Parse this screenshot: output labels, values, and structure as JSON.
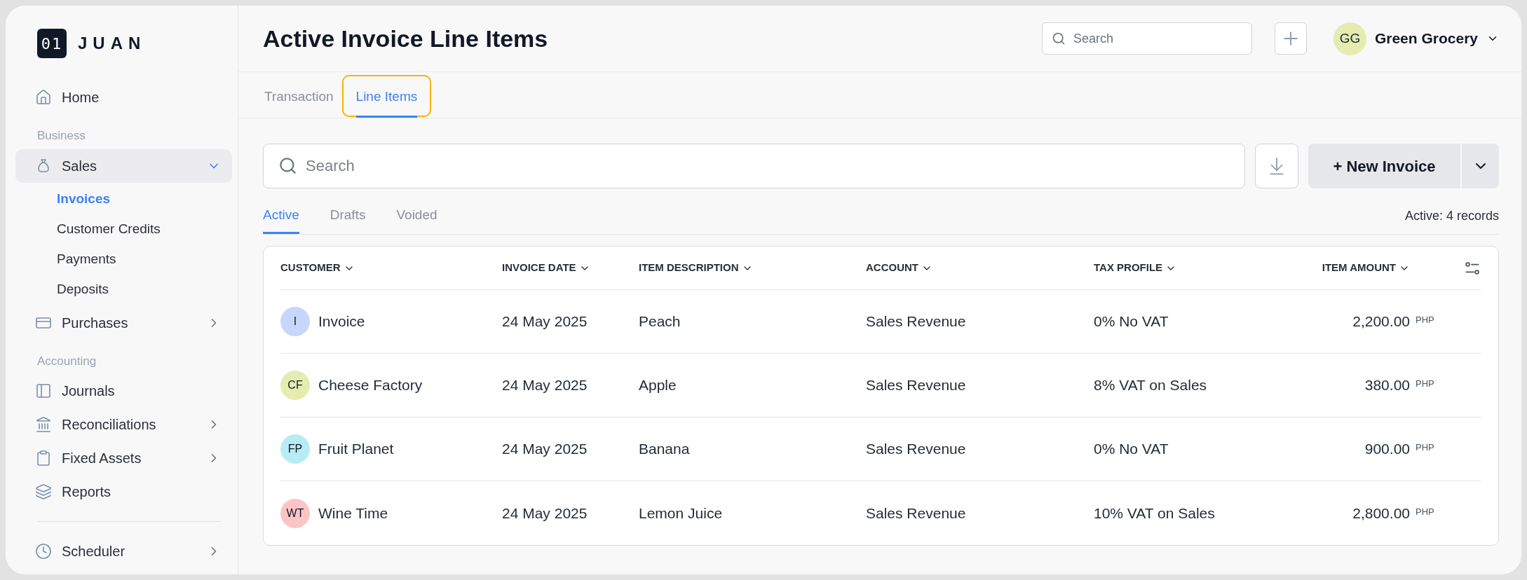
{
  "brand": {
    "badge": "01",
    "name": "JUAN"
  },
  "sidebar": {
    "nav": [
      {
        "kind": "item",
        "label": "Home"
      },
      {
        "kind": "heading",
        "label": "Business"
      },
      {
        "kind": "item",
        "label": "Sales",
        "expanded": true,
        "children": [
          {
            "label": "Invoices",
            "selected": true
          },
          {
            "label": "Customer Credits",
            "selected": false
          },
          {
            "label": "Payments",
            "selected": false
          },
          {
            "label": "Deposits",
            "selected": false
          }
        ]
      },
      {
        "kind": "item",
        "label": "Purchases",
        "expanded": false
      },
      {
        "kind": "heading",
        "label": "Accounting"
      },
      {
        "kind": "item",
        "label": "Journals"
      },
      {
        "kind": "item",
        "label": "Reconciliations",
        "expanded": false
      },
      {
        "kind": "item",
        "label": "Fixed Assets",
        "expanded": false
      },
      {
        "kind": "item",
        "label": "Reports"
      },
      {
        "kind": "divider"
      },
      {
        "kind": "item",
        "label": "Scheduler",
        "expanded": false
      }
    ]
  },
  "header": {
    "title": "Active Invoice Line Items",
    "search": {
      "placeholder": "Search"
    },
    "account": {
      "initials": "GG",
      "name": "Green Grocery"
    }
  },
  "tabs": [
    {
      "label": "Transaction",
      "selected": false,
      "focused": false
    },
    {
      "label": "Line Items",
      "selected": true,
      "focused": true
    }
  ],
  "toolbar": {
    "search": {
      "placeholder": "Search"
    },
    "new_button": "+ New Invoice"
  },
  "subtabs": [
    {
      "label": "Active",
      "selected": true
    },
    {
      "label": "Drafts",
      "selected": false
    },
    {
      "label": "Voided",
      "selected": false
    }
  ],
  "record_count": "Active: 4 records",
  "table": {
    "columns": [
      "CUSTOMER",
      "INVOICE DATE",
      "ITEM DESCRIPTION",
      "ACCOUNT",
      "TAX PROFILE",
      "ITEM AMOUNT"
    ],
    "rows": [
      {
        "initials": "I",
        "color": "#c7d7fb",
        "customer": "Invoice",
        "date": "24 May 2025",
        "description": "Peach",
        "account": "Sales Revenue",
        "tax": "0% No VAT",
        "amount": "2,200.00",
        "currency": "PHP"
      },
      {
        "initials": "CF",
        "color": "#e4ecb0",
        "customer": "Cheese Factory",
        "date": "24 May 2025",
        "description": "Apple",
        "account": "Sales Revenue",
        "tax": "8% VAT on Sales",
        "amount": "380.00",
        "currency": "PHP"
      },
      {
        "initials": "FP",
        "color": "#b7ecf5",
        "customer": "Fruit Planet",
        "date": "24 May 2025",
        "description": "Banana",
        "account": "Sales Revenue",
        "tax": "0% No VAT",
        "amount": "900.00",
        "currency": "PHP"
      },
      {
        "initials": "WT",
        "color": "#fcc4c4",
        "customer": "Wine Time",
        "date": "24 May 2025",
        "description": "Lemon Juice",
        "account": "Sales Revenue",
        "tax": "10% VAT on Sales",
        "amount": "2,800.00",
        "currency": "PHP"
      }
    ]
  }
}
